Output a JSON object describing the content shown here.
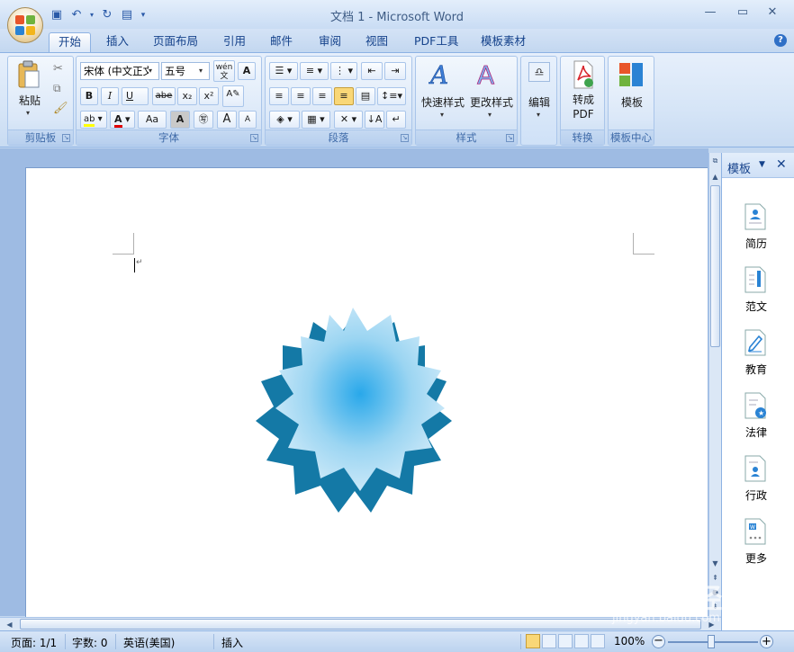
{
  "window": {
    "title": "文档 1 - Microsoft Word"
  },
  "tabs": [
    "开始",
    "插入",
    "页面布局",
    "引用",
    "邮件",
    "审阅",
    "视图",
    "PDF工具",
    "模板素材"
  ],
  "ribbon": {
    "clipboard": {
      "label": "剪贴板",
      "paste": "粘贴"
    },
    "font": {
      "label": "字体",
      "font_name": "宋体 (中文正文)",
      "font_size": "五号",
      "phonetic": "wén\n文",
      "bold": "B",
      "italic": "I",
      "underline": "U",
      "strike": "abe",
      "subscript": "x₂",
      "superscript": "x²",
      "clear": "Aa",
      "grow": "A",
      "shrink": "A"
    },
    "paragraph": {
      "label": "段落"
    },
    "styles": {
      "label": "样式",
      "quick": "快速样式",
      "change": "更改样式"
    },
    "edit": {
      "label": "编辑"
    },
    "convert": {
      "label": "转换",
      "btn": "转成\nPDF"
    },
    "template_center": {
      "label": "模板中心",
      "btn": "模板"
    }
  },
  "pane": {
    "title": "模板",
    "items": [
      "简历",
      "范文",
      "教育",
      "法律",
      "行政",
      "更多"
    ]
  },
  "status": {
    "page": "页面: 1/1",
    "words": "字数: 0",
    "language": "英语(美国)",
    "mode": "插入",
    "zoom": "100%"
  },
  "watermark": {
    "brand": "Baidu经验",
    "url": "jingyan.baidu.com"
  }
}
